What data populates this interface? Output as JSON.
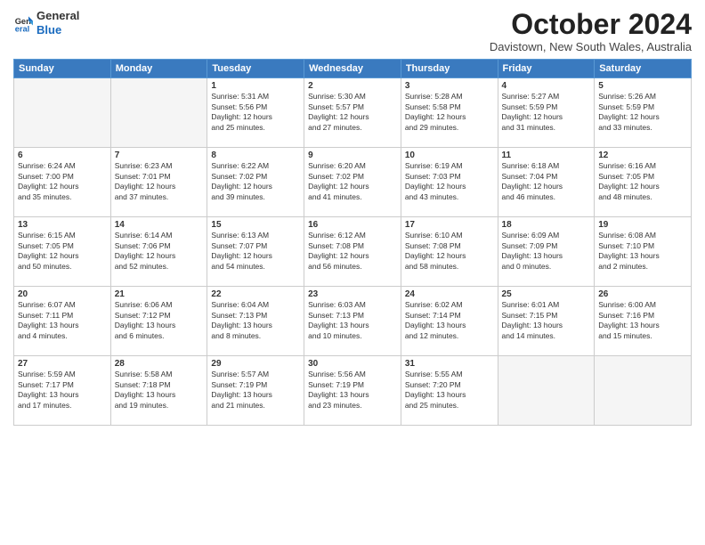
{
  "logo": {
    "general": "General",
    "blue": "Blue"
  },
  "header": {
    "month": "October 2024",
    "location": "Davistown, New South Wales, Australia"
  },
  "weekdays": [
    "Sunday",
    "Monday",
    "Tuesday",
    "Wednesday",
    "Thursday",
    "Friday",
    "Saturday"
  ],
  "weeks": [
    [
      {
        "day": "",
        "info": ""
      },
      {
        "day": "",
        "info": ""
      },
      {
        "day": "1",
        "info": "Sunrise: 5:31 AM\nSunset: 5:56 PM\nDaylight: 12 hours\nand 25 minutes."
      },
      {
        "day": "2",
        "info": "Sunrise: 5:30 AM\nSunset: 5:57 PM\nDaylight: 12 hours\nand 27 minutes."
      },
      {
        "day": "3",
        "info": "Sunrise: 5:28 AM\nSunset: 5:58 PM\nDaylight: 12 hours\nand 29 minutes."
      },
      {
        "day": "4",
        "info": "Sunrise: 5:27 AM\nSunset: 5:59 PM\nDaylight: 12 hours\nand 31 minutes."
      },
      {
        "day": "5",
        "info": "Sunrise: 5:26 AM\nSunset: 5:59 PM\nDaylight: 12 hours\nand 33 minutes."
      }
    ],
    [
      {
        "day": "6",
        "info": "Sunrise: 6:24 AM\nSunset: 7:00 PM\nDaylight: 12 hours\nand 35 minutes."
      },
      {
        "day": "7",
        "info": "Sunrise: 6:23 AM\nSunset: 7:01 PM\nDaylight: 12 hours\nand 37 minutes."
      },
      {
        "day": "8",
        "info": "Sunrise: 6:22 AM\nSunset: 7:02 PM\nDaylight: 12 hours\nand 39 minutes."
      },
      {
        "day": "9",
        "info": "Sunrise: 6:20 AM\nSunset: 7:02 PM\nDaylight: 12 hours\nand 41 minutes."
      },
      {
        "day": "10",
        "info": "Sunrise: 6:19 AM\nSunset: 7:03 PM\nDaylight: 12 hours\nand 43 minutes."
      },
      {
        "day": "11",
        "info": "Sunrise: 6:18 AM\nSunset: 7:04 PM\nDaylight: 12 hours\nand 46 minutes."
      },
      {
        "day": "12",
        "info": "Sunrise: 6:16 AM\nSunset: 7:05 PM\nDaylight: 12 hours\nand 48 minutes."
      }
    ],
    [
      {
        "day": "13",
        "info": "Sunrise: 6:15 AM\nSunset: 7:05 PM\nDaylight: 12 hours\nand 50 minutes."
      },
      {
        "day": "14",
        "info": "Sunrise: 6:14 AM\nSunset: 7:06 PM\nDaylight: 12 hours\nand 52 minutes."
      },
      {
        "day": "15",
        "info": "Sunrise: 6:13 AM\nSunset: 7:07 PM\nDaylight: 12 hours\nand 54 minutes."
      },
      {
        "day": "16",
        "info": "Sunrise: 6:12 AM\nSunset: 7:08 PM\nDaylight: 12 hours\nand 56 minutes."
      },
      {
        "day": "17",
        "info": "Sunrise: 6:10 AM\nSunset: 7:08 PM\nDaylight: 12 hours\nand 58 minutes."
      },
      {
        "day": "18",
        "info": "Sunrise: 6:09 AM\nSunset: 7:09 PM\nDaylight: 13 hours\nand 0 minutes."
      },
      {
        "day": "19",
        "info": "Sunrise: 6:08 AM\nSunset: 7:10 PM\nDaylight: 13 hours\nand 2 minutes."
      }
    ],
    [
      {
        "day": "20",
        "info": "Sunrise: 6:07 AM\nSunset: 7:11 PM\nDaylight: 13 hours\nand 4 minutes."
      },
      {
        "day": "21",
        "info": "Sunrise: 6:06 AM\nSunset: 7:12 PM\nDaylight: 13 hours\nand 6 minutes."
      },
      {
        "day": "22",
        "info": "Sunrise: 6:04 AM\nSunset: 7:13 PM\nDaylight: 13 hours\nand 8 minutes."
      },
      {
        "day": "23",
        "info": "Sunrise: 6:03 AM\nSunset: 7:13 PM\nDaylight: 13 hours\nand 10 minutes."
      },
      {
        "day": "24",
        "info": "Sunrise: 6:02 AM\nSunset: 7:14 PM\nDaylight: 13 hours\nand 12 minutes."
      },
      {
        "day": "25",
        "info": "Sunrise: 6:01 AM\nSunset: 7:15 PM\nDaylight: 13 hours\nand 14 minutes."
      },
      {
        "day": "26",
        "info": "Sunrise: 6:00 AM\nSunset: 7:16 PM\nDaylight: 13 hours\nand 15 minutes."
      }
    ],
    [
      {
        "day": "27",
        "info": "Sunrise: 5:59 AM\nSunset: 7:17 PM\nDaylight: 13 hours\nand 17 minutes."
      },
      {
        "day": "28",
        "info": "Sunrise: 5:58 AM\nSunset: 7:18 PM\nDaylight: 13 hours\nand 19 minutes."
      },
      {
        "day": "29",
        "info": "Sunrise: 5:57 AM\nSunset: 7:19 PM\nDaylight: 13 hours\nand 21 minutes."
      },
      {
        "day": "30",
        "info": "Sunrise: 5:56 AM\nSunset: 7:19 PM\nDaylight: 13 hours\nand 23 minutes."
      },
      {
        "day": "31",
        "info": "Sunrise: 5:55 AM\nSunset: 7:20 PM\nDaylight: 13 hours\nand 25 minutes."
      },
      {
        "day": "",
        "info": ""
      },
      {
        "day": "",
        "info": ""
      }
    ]
  ]
}
